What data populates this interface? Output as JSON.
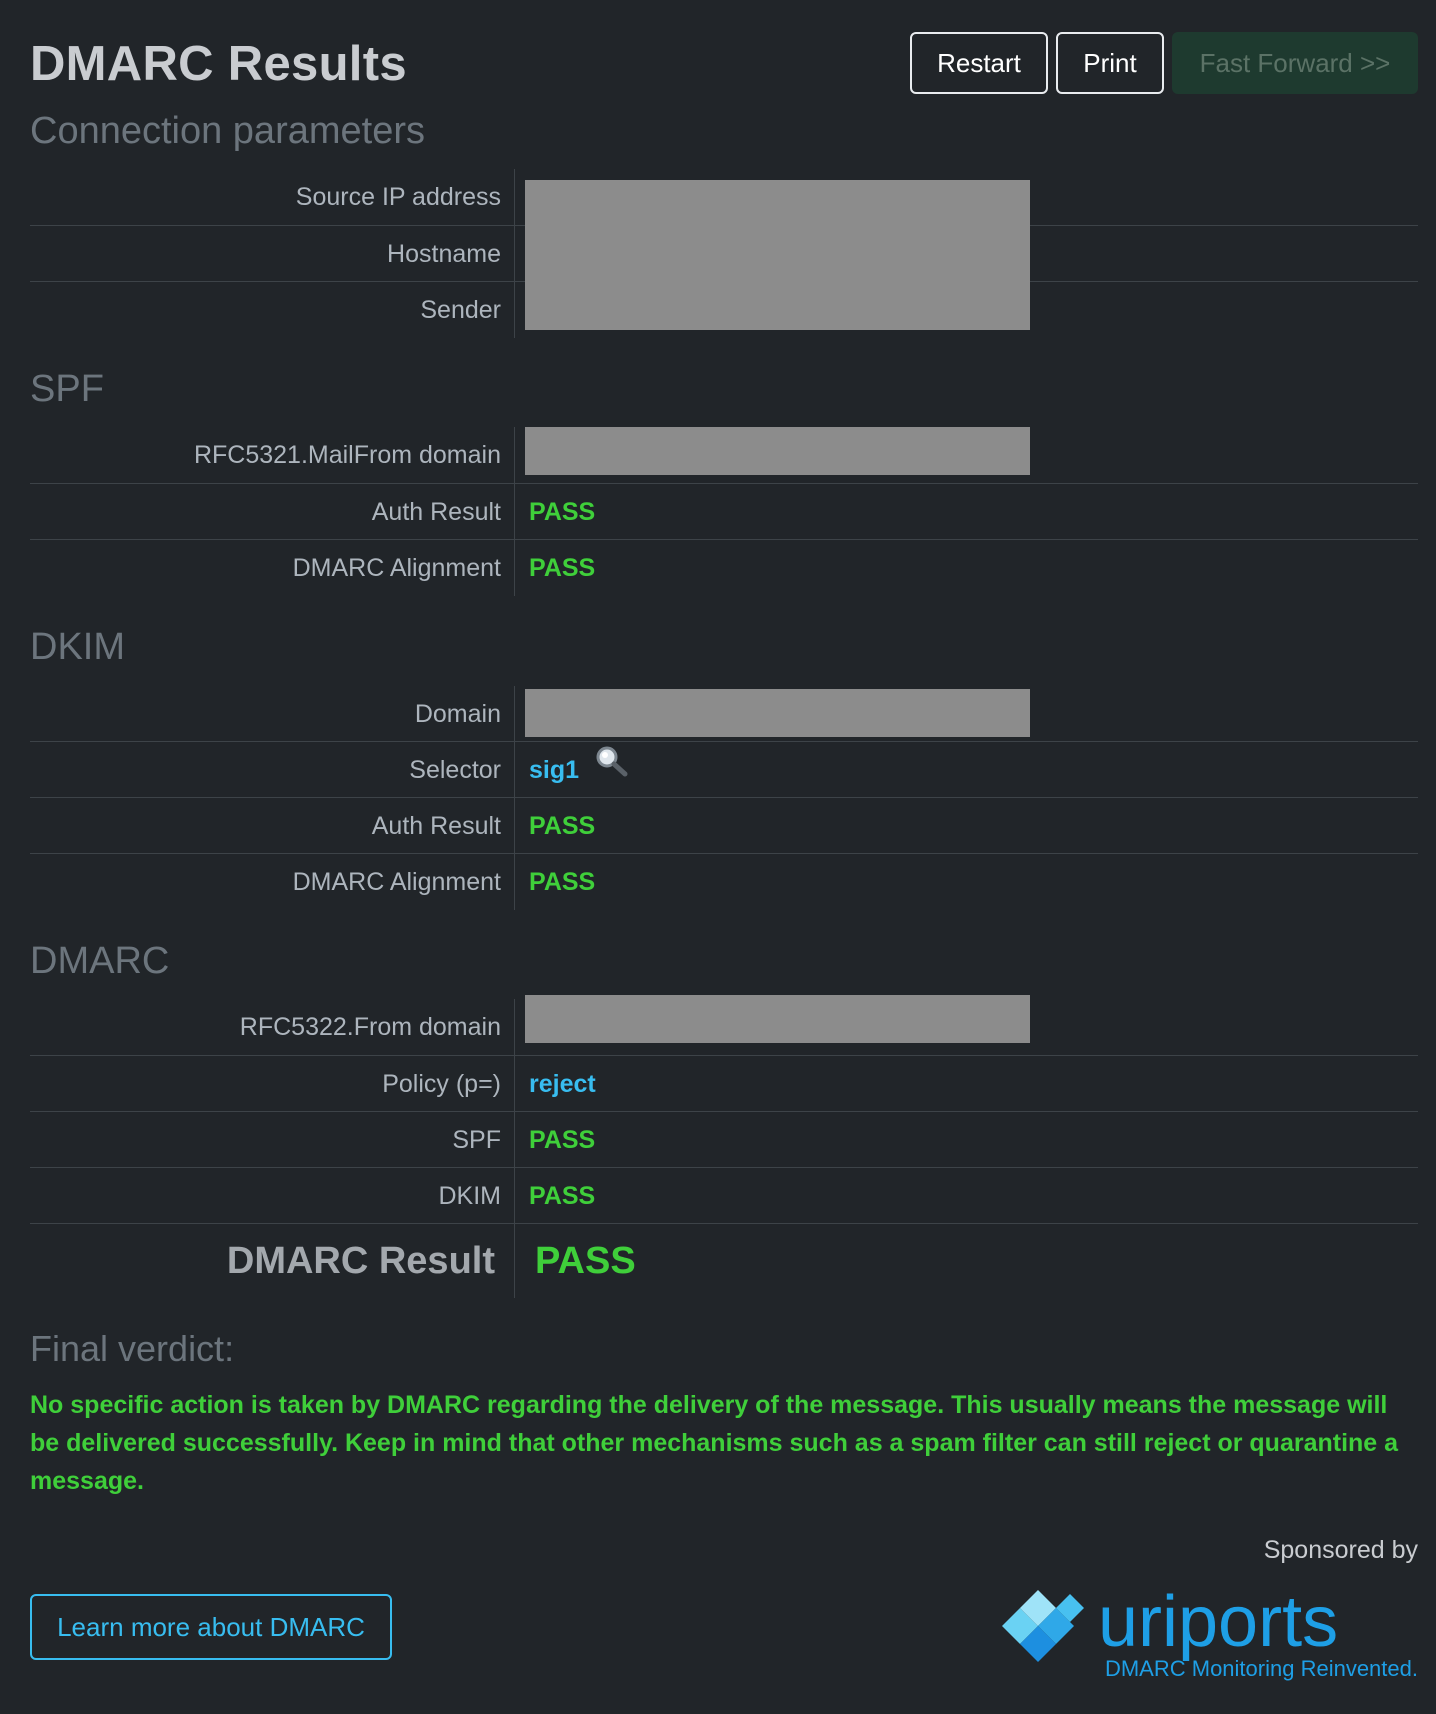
{
  "header": {
    "title": "DMARC Results",
    "buttons": {
      "restart": "Restart",
      "print": "Print",
      "fast_forward": "Fast Forward >>"
    }
  },
  "connection": {
    "heading": "Connection parameters",
    "rows": [
      {
        "label": "Source IP address"
      },
      {
        "label": "Hostname"
      },
      {
        "label": "Sender"
      }
    ]
  },
  "spf": {
    "heading": "SPF",
    "rows": [
      {
        "label": "RFC5321.MailFrom domain"
      },
      {
        "label": "Auth Result",
        "value": "PASS"
      },
      {
        "label": "DMARC Alignment",
        "value": "PASS"
      }
    ]
  },
  "dkim": {
    "heading": "DKIM",
    "rows": [
      {
        "label": "Domain"
      },
      {
        "label": "Selector",
        "value": "sig1"
      },
      {
        "label": "Auth Result",
        "value": "PASS"
      },
      {
        "label": "DMARC Alignment",
        "value": "PASS"
      }
    ]
  },
  "dmarc": {
    "heading": "DMARC",
    "rows": [
      {
        "label": "RFC5322.From domain"
      },
      {
        "label": "Policy (p=)",
        "value": "reject"
      },
      {
        "label": "SPF",
        "value": "PASS"
      },
      {
        "label": "DKIM",
        "value": "PASS"
      }
    ],
    "result_label": "DMARC Result",
    "result_value": "PASS"
  },
  "verdict": {
    "heading": "Final verdict:",
    "text": "No specific action is taken by DMARC regarding the delivery of the message. This usually means the message will be delivered successfully. Keep in mind that other mechanisms such as a spam filter can still reject or quarantine a message."
  },
  "footer": {
    "learn_more": "Learn more about DMARC",
    "sponsored": "Sponsored by",
    "logo_text": "uriports",
    "tagline": "DMARC Monitoring Reinvented."
  },
  "colors": {
    "pass": "#3fcf3a",
    "link": "#38bdf0",
    "background": "#212529",
    "redaction": "#8c8c8c"
  },
  "icons": {
    "selector_lookup": "magnifier-icon"
  }
}
